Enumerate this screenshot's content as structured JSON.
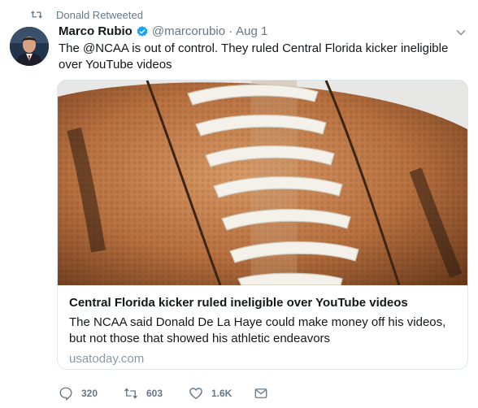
{
  "retweet_banner": {
    "label": "Donald Retweeted",
    "icon": "retweet-icon"
  },
  "author": {
    "name": "Marco Rubio",
    "handle": "@marcorubio",
    "separator": "·",
    "date": "Aug 1",
    "verified_icon": "verified-badge-icon",
    "avatar_icon": "profile-photo"
  },
  "tweet": {
    "text": "The @NCAA is out of control. They ruled Central Florida kicker ineligible over YouTube videos"
  },
  "card": {
    "image_icon": "football-photo",
    "title": "Central Florida kicker ruled ineligible over YouTube videos",
    "description": "The NCAA said Donald De La Haye could make money off his videos, but not those that showed his athletic endeavors",
    "domain": "usatoday.com"
  },
  "actions": {
    "reply_count": "320",
    "retweet_count": "603",
    "like_count": "1.6K"
  },
  "colors": {
    "text": "#14171a",
    "secondary": "#657786",
    "muted": "#8899a6",
    "verified": "#1da1f2",
    "border": "#e1e8ed"
  }
}
